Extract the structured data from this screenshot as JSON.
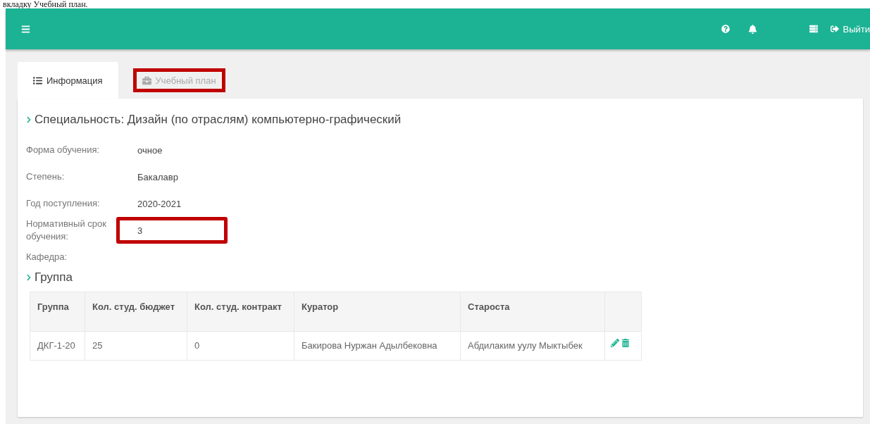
{
  "document_caption": "вкладку Учебный план.",
  "header": {
    "logout": "Выйти"
  },
  "tabs": [
    {
      "label": "Информация",
      "selected": true,
      "highlighted": false,
      "kind": "list"
    },
    {
      "label": "Учебный план",
      "selected": false,
      "highlighted": true,
      "kind": "briefcase"
    }
  ],
  "specialty": "Специальность: Дизайн (по отраслям) компьютерно-графический",
  "fields": [
    {
      "label": "Форма обучения:",
      "value": "очное",
      "highlighted": false
    },
    {
      "label": "Степень:",
      "value": "Бакалавр",
      "highlighted": false
    },
    {
      "label": "Год поступления:",
      "value": "2020-2021",
      "highlighted": false
    },
    {
      "label": "Нормативный срок обучения:",
      "value": "3",
      "highlighted": true
    },
    {
      "label": "Кафедра:",
      "highlighted": false
    }
  ],
  "group_heading": "Группа",
  "table": {
    "columns": [
      "Группа",
      "Кол. студ. бюджет",
      "Кол. студ. контракт",
      "Куратор",
      "Староста"
    ],
    "rows": [
      {
        "cells": [
          "ДКГ-1-20",
          "25",
          "0",
          "Бакирова Нуржан Адылбековна",
          "Абдилаким уулу Мыктыбек"
        ]
      }
    ]
  }
}
